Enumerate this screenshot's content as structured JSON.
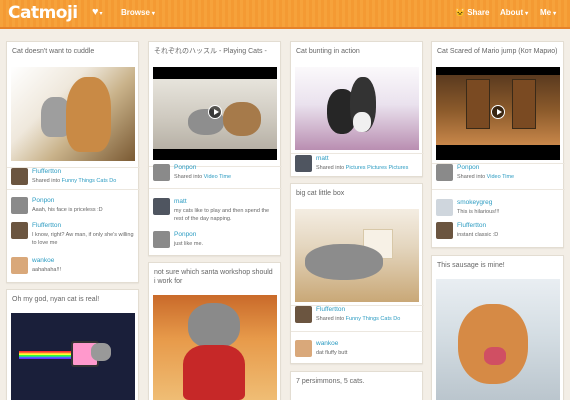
{
  "header": {
    "logo": "Catmoji",
    "browse": "Browse",
    "share": "Share",
    "about": "About",
    "me": "Me"
  },
  "cards": {
    "c1": {
      "title": "Cat doesn't want to cuddle",
      "posts": [
        {
          "user": "Fluffertton",
          "prefix": "Shared into ",
          "link": "Funny Things Cats Do"
        },
        {
          "user": "Ponpon",
          "text": "Aaah, his face is priceless :D"
        },
        {
          "user": "Fluffertton",
          "text": "I know, right? Aw man, if only she's willing to love me"
        },
        {
          "user": "wankoe",
          "text": "aahahaha!!!"
        }
      ]
    },
    "c2": {
      "title": "Oh my god, nyan cat is real!"
    },
    "c3": {
      "title": "それぞれのハッスル - Playing Cats -",
      "posts": [
        {
          "user": "Ponpon",
          "prefix": "Shared into ",
          "link": "Video Time"
        },
        {
          "user": "matt",
          "text": "my cats like to play and then spend the rest of the day napping."
        },
        {
          "user": "Ponpon",
          "text": "just like me."
        }
      ]
    },
    "c4": {
      "title": "not sure which santa workshop should i work for"
    },
    "c5": {
      "title": "Cat bunting in action",
      "posts": [
        {
          "user": "matt",
          "prefix": "Shared into ",
          "link": "Pictures Pictures Pictures"
        }
      ]
    },
    "c6": {
      "title": "big cat little box",
      "posts": [
        {
          "user": "Fluffertton",
          "prefix": "Shared into ",
          "link": "Funny Things Cats Do"
        },
        {
          "user": "wankoe",
          "text": "dat fluffy butt"
        }
      ]
    },
    "c7": {
      "title": "7 persimmons, 5 cats."
    },
    "c8": {
      "title": "Cat Scared of Mario jump (Кот Марио)",
      "posts": [
        {
          "user": "Ponpon",
          "prefix": "Shared into ",
          "link": "Video Time"
        },
        {
          "user": "smokeygreg",
          "text": "This is hilarious!!!"
        },
        {
          "user": "Fluffertton",
          "text": "instant classic :D"
        }
      ]
    },
    "c9": {
      "title": "This sausage is mine!"
    }
  },
  "colors": {
    "header": "#f49a33",
    "link": "#2d9cc2",
    "background": "#f3eee6"
  }
}
